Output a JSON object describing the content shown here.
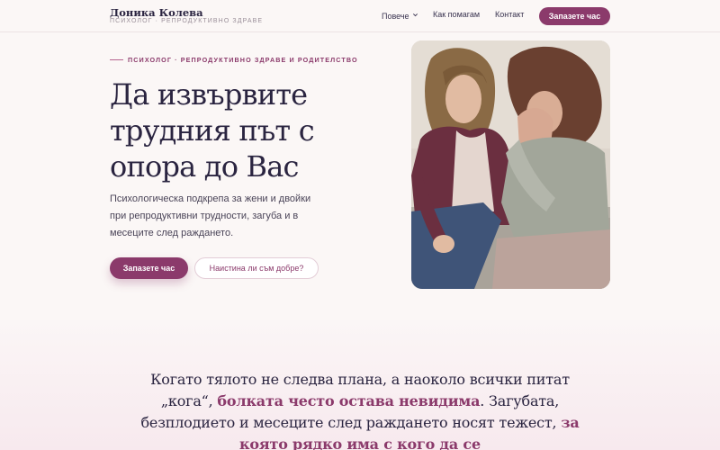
{
  "brand": {
    "name": "Доника Колева",
    "tagline": "ПСИХОЛОГ · РЕПРОДУКТИВНО ЗДРАВЕ"
  },
  "nav": {
    "more_label": "Повече",
    "how_label": "Как помагам",
    "contact_label": "Контакт",
    "book_label": "Запазете час"
  },
  "hero": {
    "eyebrow": "ПСИХОЛОГ · РЕПРОДУКТИВНО ЗДРАВЕ И РОДИТЕЛСТВО",
    "title_line1": "Да извървите",
    "title_line2": "трудния път с",
    "title_line3": "опора до Вас",
    "subtitle": "Психологическа подкрепа за жени и двойки при репродуктивни трудности, загуба и в месеците след раждането.",
    "primary_cta": "Запазете час",
    "secondary_cta": "Наистина ли съм добре?"
  },
  "quote": {
    "part1": "Когато тялото не следва плана, а наоколо всички питат „кога“, ",
    "highlight1": "болката често остава невидима",
    "part2": ". Загубата, безплодието и месеците след раждането носят тежест, ",
    "highlight2": "за която рядко има с кого да се"
  },
  "colors": {
    "accent": "#8b3a6b",
    "text": "#2a2440",
    "background": "#fbf7f6"
  },
  "icons": {
    "nav_more": "chevron-down-icon"
  }
}
